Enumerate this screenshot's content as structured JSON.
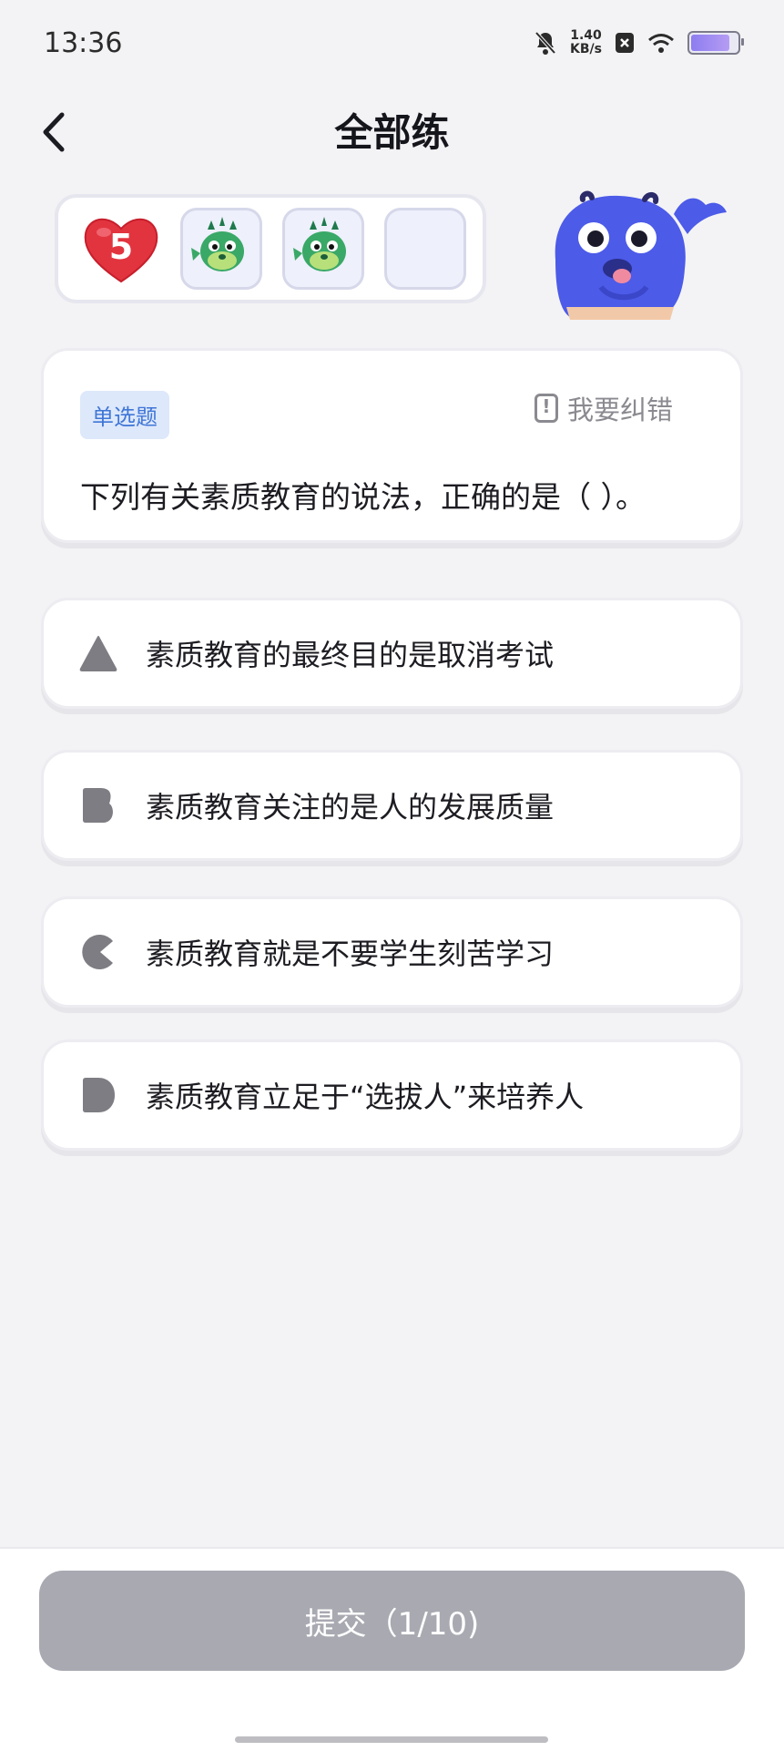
{
  "status_bar": {
    "time": "13:36",
    "net_speed_value": "1.40",
    "net_speed_unit": "KB/s",
    "battery_level": 0.78,
    "icons": [
      "mute-bell-icon",
      "close-box-icon",
      "wifi-icon",
      "battery-icon"
    ]
  },
  "header": {
    "title": "全部练",
    "back_icon": "chevron-left-icon"
  },
  "lives": {
    "hearts": "5",
    "slots": [
      "pufferfish-icon",
      "pufferfish-icon",
      "empty"
    ]
  },
  "question": {
    "type_tag": "单选题",
    "report_label": "我要纠错",
    "text": "下列有关素质教育的说法，正确的是（ ）。"
  },
  "options": [
    {
      "key": "A",
      "icon": "triangle-icon",
      "text": "素质教育的最终目的是取消考试"
    },
    {
      "key": "B",
      "icon": "b-shape-icon",
      "text": "素质教育关注的是人的发展质量"
    },
    {
      "key": "C",
      "icon": "pacman-icon",
      "text": "素质教育就是不要学生刻苦学习"
    },
    {
      "key": "D",
      "icon": "d-shape-icon",
      "text": "素质教育立足于“选拔人”来培养人"
    }
  ],
  "submit": {
    "label": "提交（1/10)"
  },
  "colors": {
    "background": "#f3f3f5",
    "heart": "#e2343f",
    "tag_bg": "#dde8fb",
    "tag_text": "#3f76d6",
    "submit_disabled": "#a8a9b1",
    "mascot": "#4c5be8"
  }
}
